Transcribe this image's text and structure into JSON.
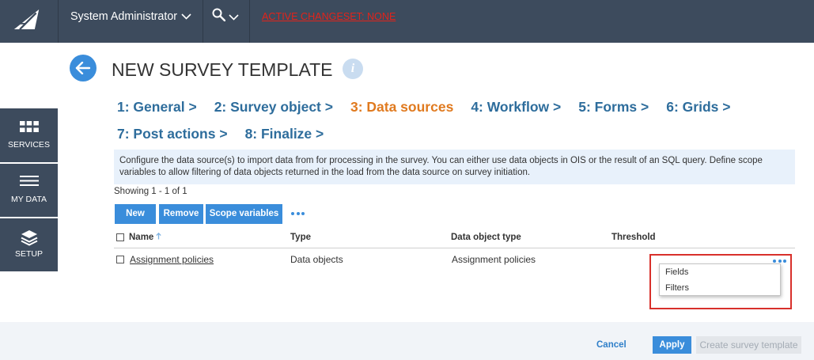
{
  "colors": {
    "topbar": "#3d4b5d",
    "sidebar": "#3d4b5d",
    "accent": "#3a8ddb",
    "step": "#2e6d9c",
    "step_active": "#e07a1f",
    "changeset": "#e2231a",
    "highlight": "#d8302b"
  },
  "topbar": {
    "logo_icon": "logo-icon",
    "user_label": "System Administrator",
    "user_menu_icon": "chevron-down-icon",
    "search_icon": "search-icon",
    "search_menu_icon": "chevron-down-icon",
    "changeset_label": "ACTIVE CHANGESET: NONE"
  },
  "sidebar": {
    "items": [
      {
        "label": "SERVICES",
        "icon": "grid-icon"
      },
      {
        "label": "MY DATA",
        "icon": "menu-icon"
      },
      {
        "label": "SETUP",
        "icon": "layers-icon"
      }
    ]
  },
  "page": {
    "back_icon": "back-arrow-icon",
    "title": "NEW SURVEY TEMPLATE",
    "info_icon": "info-icon",
    "info_glyph": "i"
  },
  "steps": [
    {
      "label": "1: General >",
      "active": false
    },
    {
      "label": "2: Survey object >",
      "active": false
    },
    {
      "label": "3: Data sources",
      "active": true
    },
    {
      "label": "4: Workflow >",
      "active": false
    },
    {
      "label": "5: Forms >",
      "active": false
    },
    {
      "label": "6: Grids >",
      "active": false
    },
    {
      "label": "7: Post actions >",
      "active": false
    },
    {
      "label": "8: Finalize >",
      "active": false
    }
  ],
  "description": "Configure the data source(s) to import data from for processing in the survey. You can either use data objects in OIS or the result of an SQL query. Define scope variables to allow filtering of data objects returned in the load from the data source on survey initiation.",
  "showing": "Showing 1 - 1 of 1",
  "toolbar": {
    "new_label": "New",
    "remove_label": "Remove",
    "scope_label": "Scope variables",
    "more_icon": "more-options-icon"
  },
  "table": {
    "select_all_checked": false,
    "sort_icon": "sort-ascending-icon",
    "columns": {
      "name": "Name",
      "type": "Type",
      "data_object_type": "Data object type",
      "threshold": "Threshold"
    },
    "rows": [
      {
        "checked": false,
        "name": "Assignment policies",
        "type": "Data objects",
        "data_object_type": "Assignment policies",
        "threshold": "",
        "more_icon": "more-options-icon"
      }
    ]
  },
  "context_menu": {
    "items": [
      "Fields",
      "Filters"
    ]
  },
  "footer": {
    "cancel_label": "Cancel",
    "apply_label": "Apply",
    "create_label": "Create survey template",
    "create_enabled": false
  }
}
